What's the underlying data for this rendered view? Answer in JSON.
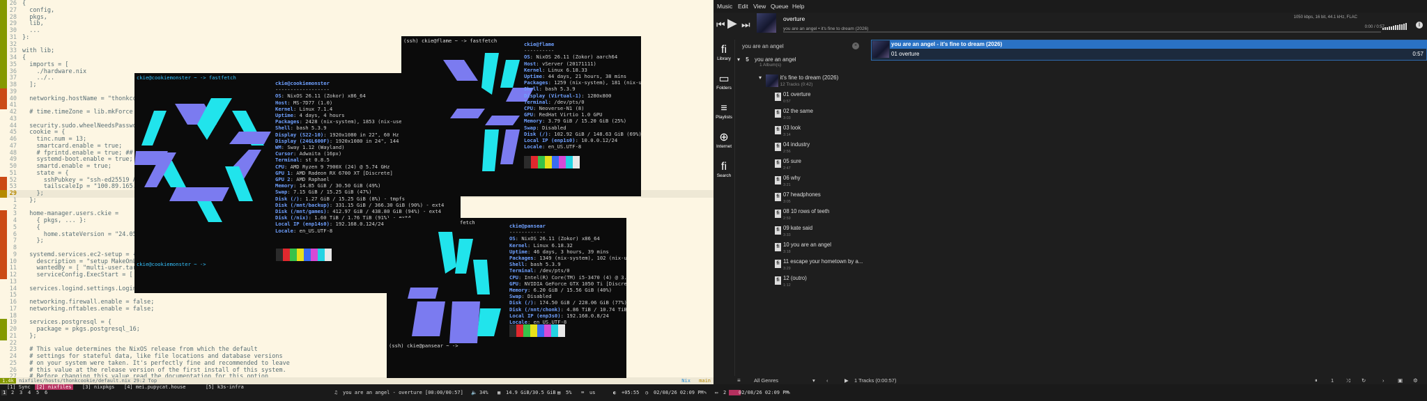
{
  "editor": {
    "lines": [
      {
        "n": "26",
        "t": "{",
        "g": "add"
      },
      {
        "n": "27",
        "t": "  config,",
        "g": "add"
      },
      {
        "n": "28",
        "t": "  pkgs,",
        "g": "add"
      },
      {
        "n": "29",
        "t": "  lib,",
        "g": "add"
      },
      {
        "n": "30",
        "t": "  ...",
        "g": "add"
      },
      {
        "n": "31",
        "t": "}:",
        "g": "add"
      },
      {
        "n": "32",
        "t": "",
        "g": "add"
      },
      {
        "n": "33",
        "t": "with lib;",
        "g": "add"
      },
      {
        "n": "34",
        "t": "{",
        "g": "add"
      },
      {
        "n": "35",
        "t": "  imports = [",
        "g": "add"
      },
      {
        "n": "36",
        "t": "    ./hardware.nix",
        "g": "add"
      },
      {
        "n": "37",
        "t": "    ../..",
        "g": "add"
      },
      {
        "n": "38",
        "t": "  ];",
        "g": "add"
      },
      {
        "n": "39",
        "t": "",
        "g": "mod"
      },
      {
        "n": "40",
        "t": "  networking.hostName = \"thonkcookie\";",
        "g": "mod"
      },
      {
        "n": "41",
        "t": "",
        "g": "mod"
      },
      {
        "n": "42",
        "t": "  # time.timeZone = lib.mkForce null;",
        "g": ""
      },
      {
        "n": "43",
        "t": "",
        "g": ""
      },
      {
        "n": "44",
        "t": "  security.sudo.wheelNeedsPassword = false;",
        "g": ""
      },
      {
        "n": "45",
        "t": "  cookie = {",
        "g": ""
      },
      {
        "n": "46",
        "t": "    tinc.num = 13;",
        "g": ""
      },
      {
        "n": "47",
        "t": "    smartcard.enable = true;",
        "g": ""
      },
      {
        "n": "48",
        "t": "    # fprintd.enable = true; ## broken",
        "g": ""
      },
      {
        "n": "49",
        "t": "    systemd-boot.enable = true;",
        "g": ""
      },
      {
        "n": "50",
        "t": "    smartd.enable = true;",
        "g": ""
      },
      {
        "n": "51",
        "t": "    state = {",
        "g": ""
      },
      {
        "n": "52",
        "t": "      sshPubkey = \"ssh-ed25519 AAAAC3Nza...\";",
        "g": "mod"
      },
      {
        "n": "53",
        "t": "      tailscaleIp = \"100.89.165.81\";",
        "g": "mod"
      },
      {
        "n": "29",
        "t": "    };",
        "g": "del",
        "cur": true
      },
      {
        "n": "1",
        "t": "  };",
        "g": ""
      },
      {
        "n": "2",
        "t": "",
        "g": ""
      },
      {
        "n": "3",
        "t": "  home-manager.users.ckie =",
        "g": "mod"
      },
      {
        "n": "4",
        "t": "    { pkgs, ... }:",
        "g": "mod"
      },
      {
        "n": "5",
        "t": "    {",
        "g": "mod"
      },
      {
        "n": "6",
        "t": "      home.stateVersion = \"24.05\";",
        "g": "mod"
      },
      {
        "n": "7",
        "t": "    };",
        "g": "mod"
      },
      {
        "n": "8",
        "t": "",
        "g": "mod"
      },
      {
        "n": "9",
        "t": "  systemd.services.ec2-setup = {",
        "g": "mod"
      },
      {
        "n": "10",
        "t": "    description = \"setup MakeOnLan\";",
        "g": "mod"
      },
      {
        "n": "11",
        "t": "    wantedBy = [ \"multi-user.target\" ];",
        "g": "mod"
      },
      {
        "n": "12",
        "t": "    serviceConfig.ExecStart = [ \"${pkgs.ethtool}...",
        "g": "mod"
      },
      {
        "n": "13",
        "t": "",
        "g": ""
      },
      {
        "n": "14",
        "t": "  services.logind.settings.Login.HandleLidSwitch...",
        "g": ""
      },
      {
        "n": "15",
        "t": "",
        "g": ""
      },
      {
        "n": "16",
        "t": "  networking.firewall.enable = false;",
        "g": ""
      },
      {
        "n": "17",
        "t": "  networking.nftables.enable = false;",
        "g": ""
      },
      {
        "n": "18",
        "t": "",
        "g": ""
      },
      {
        "n": "19",
        "t": "  services.postgresql = {",
        "g": "add"
      },
      {
        "n": "20",
        "t": "    package = pkgs.postgresql_16;",
        "g": "add"
      },
      {
        "n": "21",
        "t": "  };",
        "g": "add"
      },
      {
        "n": "22",
        "t": "",
        "g": ""
      },
      {
        "n": "23",
        "t": "  # This value determines the NixOS release from which the default",
        "g": ""
      },
      {
        "n": "24",
        "t": "  # settings for stateful data, like file locations and database versions",
        "g": ""
      },
      {
        "n": "25",
        "t": "  # on your system were taken. It's perfectly fine and recommended to leave",
        "g": ""
      },
      {
        "n": "26",
        "t": "  # this value at the release version of the first install of this system.",
        "g": ""
      },
      {
        "n": "27",
        "t": "  # Before changing this value read the documentation for this option",
        "g": ""
      }
    ],
    "status": {
      "mode": "1.4k",
      "file": "nixfiles/hosts/thonkcookie/default.nix",
      "pos": "29:2 Top",
      "lang": "Nix",
      "branch": "main"
    }
  },
  "term1": {
    "prompt": "ckie@cookiemonster ~ -> fastfetch",
    "prompt2": "ckie@cookiemonster ~ ->",
    "header": "ckie@cookiemonster",
    "sep": "------------------",
    "info": [
      {
        "k": "OS",
        "v": "NixOS 26.11 (Zokor) x86_64"
      },
      {
        "k": "Host",
        "v": "MS-7D77 (1.0)"
      },
      {
        "k": "Kernel",
        "v": "Linux 7.1.4"
      },
      {
        "k": "Uptime",
        "v": "4 days, 4 hours"
      },
      {
        "k": "Packages",
        "v": "2428 (nix-system), 1853 (nix-user)"
      },
      {
        "k": "Shell",
        "v": "bash 5.3.9"
      },
      {
        "k": "Display (S22-10)",
        "v": "1920x1080 in 22\", 60 Hz [External]"
      },
      {
        "k": "Display (24GL600F)",
        "v": "1920x1080 in 24\", 144 Hz [External]"
      },
      {
        "k": "WM",
        "v": "Sway 1.12 (Wayland)"
      },
      {
        "k": "Cursor",
        "v": "Adwaita (16px)"
      },
      {
        "k": "Terminal",
        "v": "st 0.8.5"
      },
      {
        "k": "CPU",
        "v": "AMD Ryzen 9 7900X (24) @ 5.74 GHz"
      },
      {
        "k": "GPU 1",
        "v": "AMD Radeon RX 6700 XT [Discrete]"
      },
      {
        "k": "GPU 2",
        "v": "AMD Raphael"
      },
      {
        "k": "Memory",
        "v": "14.85 GiB / 30.50 GiB (49%)"
      },
      {
        "k": "Swap",
        "v": "7.15 GiB / 15.25 GiB (47%)"
      },
      {
        "k": "Disk (/)",
        "v": "1.27 GiB / 15.25 GiB (8%) - tmpfs"
      },
      {
        "k": "Disk (/mnt/backup)",
        "v": "331.15 GiB / 366.30 GiB (90%) - ext4"
      },
      {
        "k": "Disk (/mnt/games)",
        "v": "412.97 GiB / 438.80 GiB (94%) - ext4"
      },
      {
        "k": "Disk (/nix)",
        "v": "1.60 TiB / 1.76 TiB (91%) - ext4"
      },
      {
        "k": "Local IP (enp14s0)",
        "v": "192.168.0.124/24"
      },
      {
        "k": "Locale",
        "v": "en_US.UTF-8"
      }
    ]
  },
  "term2": {
    "prompt": "(ssh) ckie@flame ~ -> fastfetch",
    "header": "ckie@flame",
    "sep": "----------",
    "info": [
      {
        "k": "OS",
        "v": "NixOS 26.11 (Zokor) aarch64"
      },
      {
        "k": "Host",
        "v": "vServer (20171111)"
      },
      {
        "k": "Kernel",
        "v": "Linux 6.18.33"
      },
      {
        "k": "Uptime",
        "v": "44 days, 21 hours, 38 mins"
      },
      {
        "k": "Packages",
        "v": "1259 (nix-system), 181 (nix-user)"
      },
      {
        "k": "Shell",
        "v": "bash 5.3.9"
      },
      {
        "k": "Display (Virtual-1)",
        "v": "1280x800"
      },
      {
        "k": "Terminal",
        "v": "/dev/pts/0"
      },
      {
        "k": "CPU",
        "v": "Neoverse-N1 (8)"
      },
      {
        "k": "GPU",
        "v": "RedHat Virtio 1.0 GPU"
      },
      {
        "k": "Memory",
        "v": "3.79 GiB / 15.20 GiB (25%)"
      },
      {
        "k": "Swap",
        "v": "Disabled"
      },
      {
        "k": "Disk (/)",
        "v": "102.92 GiB / 148.63 GiB (69%) - ext4"
      },
      {
        "k": "Local IP (enp1s0)",
        "v": "10.0.0.12/24"
      },
      {
        "k": "Locale",
        "v": "en_US.UTF-8"
      }
    ]
  },
  "term3": {
    "prompt": "(ssh) ckie@pansear ~ -> fastfetch",
    "prompt2": "(ssh) ckie@pansear ~ ->",
    "header": "ckie@pansear",
    "sep": "------------",
    "info": [
      {
        "k": "OS",
        "v": "NixOS 26.11 (Zokor) x86_64"
      },
      {
        "k": "Kernel",
        "v": "Linux 6.18.32"
      },
      {
        "k": "Uptime",
        "v": "46 days, 3 hours, 39 mins"
      },
      {
        "k": "Packages",
        "v": "1349 (nix-system), 102 (nix-user)"
      },
      {
        "k": "Shell",
        "v": "bash 5.3.9"
      },
      {
        "k": "Terminal",
        "v": "/dev/pts/0"
      },
      {
        "k": "CPU",
        "v": "Intel(R) Core(TM) i5-3470 (4) @ 3.60 GHz"
      },
      {
        "k": "GPU",
        "v": "NVIDIA GeForce GTX 1050 Ti [Discrete]"
      },
      {
        "k": "Memory",
        "v": "6.20 GiB / 15.56 GiB (40%)"
      },
      {
        "k": "Swap",
        "v": "Disabled"
      },
      {
        "k": "Disk (/)",
        "v": "174.50 GiB / 228.06 GiB (77%) - ext4"
      },
      {
        "k": "Disk (/nnt/chonk)",
        "v": "4.86 TiB / 10.74 TiB (45%)"
      },
      {
        "k": "Local IP (enp3s0)",
        "v": "192.168.0.8/24"
      },
      {
        "k": "Locale",
        "v": "en_US.UTF-8"
      }
    ]
  },
  "player": {
    "menu": [
      "Music",
      "Edit",
      "View",
      "Queue",
      "Help"
    ],
    "now_title": "overture",
    "now_sub": "you are an angel • it's fine to dream (2026)",
    "tech": "1050 kbps, 16 bit, 44.1 kHz, FLAC",
    "time": "0:00 / 0:57",
    "tabs": [
      {
        "label": "Library",
        "icon": "fi"
      },
      {
        "label": "Folders",
        "icon": "▭"
      },
      {
        "label": "Playlists",
        "icon": "≡"
      },
      {
        "label": "Internet",
        "icon": "⊕"
      },
      {
        "label": "Search",
        "icon": "fi"
      }
    ],
    "search_value": "you are an angel",
    "artist": "you are an angel",
    "artist_count": "5",
    "artist_sub": "1 Album(s)",
    "album": "it's fine to dream (2026)",
    "album_sub": "12 Tracks (0:42)",
    "tracks": [
      {
        "name": "01 overture",
        "dur": "0:57"
      },
      {
        "name": "02 the same",
        "dur": "3:03"
      },
      {
        "name": "03 look",
        "dur": "3:14"
      },
      {
        "name": "04 industry",
        "dur": "2:56"
      },
      {
        "name": "05 sure",
        "dur": "2:47"
      },
      {
        "name": "06 why",
        "dur": "3:21"
      },
      {
        "name": "07 headphones",
        "dur": "3:05"
      },
      {
        "name": "08 10 rows of teeth",
        "dur": "2:59"
      },
      {
        "name": "09 kate said",
        "dur": "3:33"
      },
      {
        "name": "10 you are an angel",
        "dur": "3:18"
      },
      {
        "name": "11 escape your hometown by a...",
        "dur": "3:29"
      },
      {
        "name": "12 (outro)",
        "dur": "1:12"
      }
    ],
    "pl_header": "you are an angel - it's fine to dream (2026)",
    "pl_row": "01 overture",
    "pl_row_dur": "0:57",
    "genre": "All Genres",
    "track_count": "1 Tracks (0:00:57)"
  },
  "taskbar": {
    "workspaces": [
      "1",
      "2",
      "3",
      "4",
      "5",
      "6"
    ],
    "titles": [
      "[1] Sync",
      "[2] nixfiles",
      "[3] nixpkgs",
      "[4] mei.pupycat.house",
      "[5] k3s-infra"
    ],
    "music": "you are an angel - overture [00:00/00:57]",
    "vol": "34%",
    "mem": "14.9 GiB/30.5 GiB",
    "cpu": "5%",
    "locale": "us",
    "tz": "+05:55",
    "date1": "02/08/26 02:09 PM",
    "ws2": "2",
    "date2": "02/08/26 02:09 PM"
  }
}
